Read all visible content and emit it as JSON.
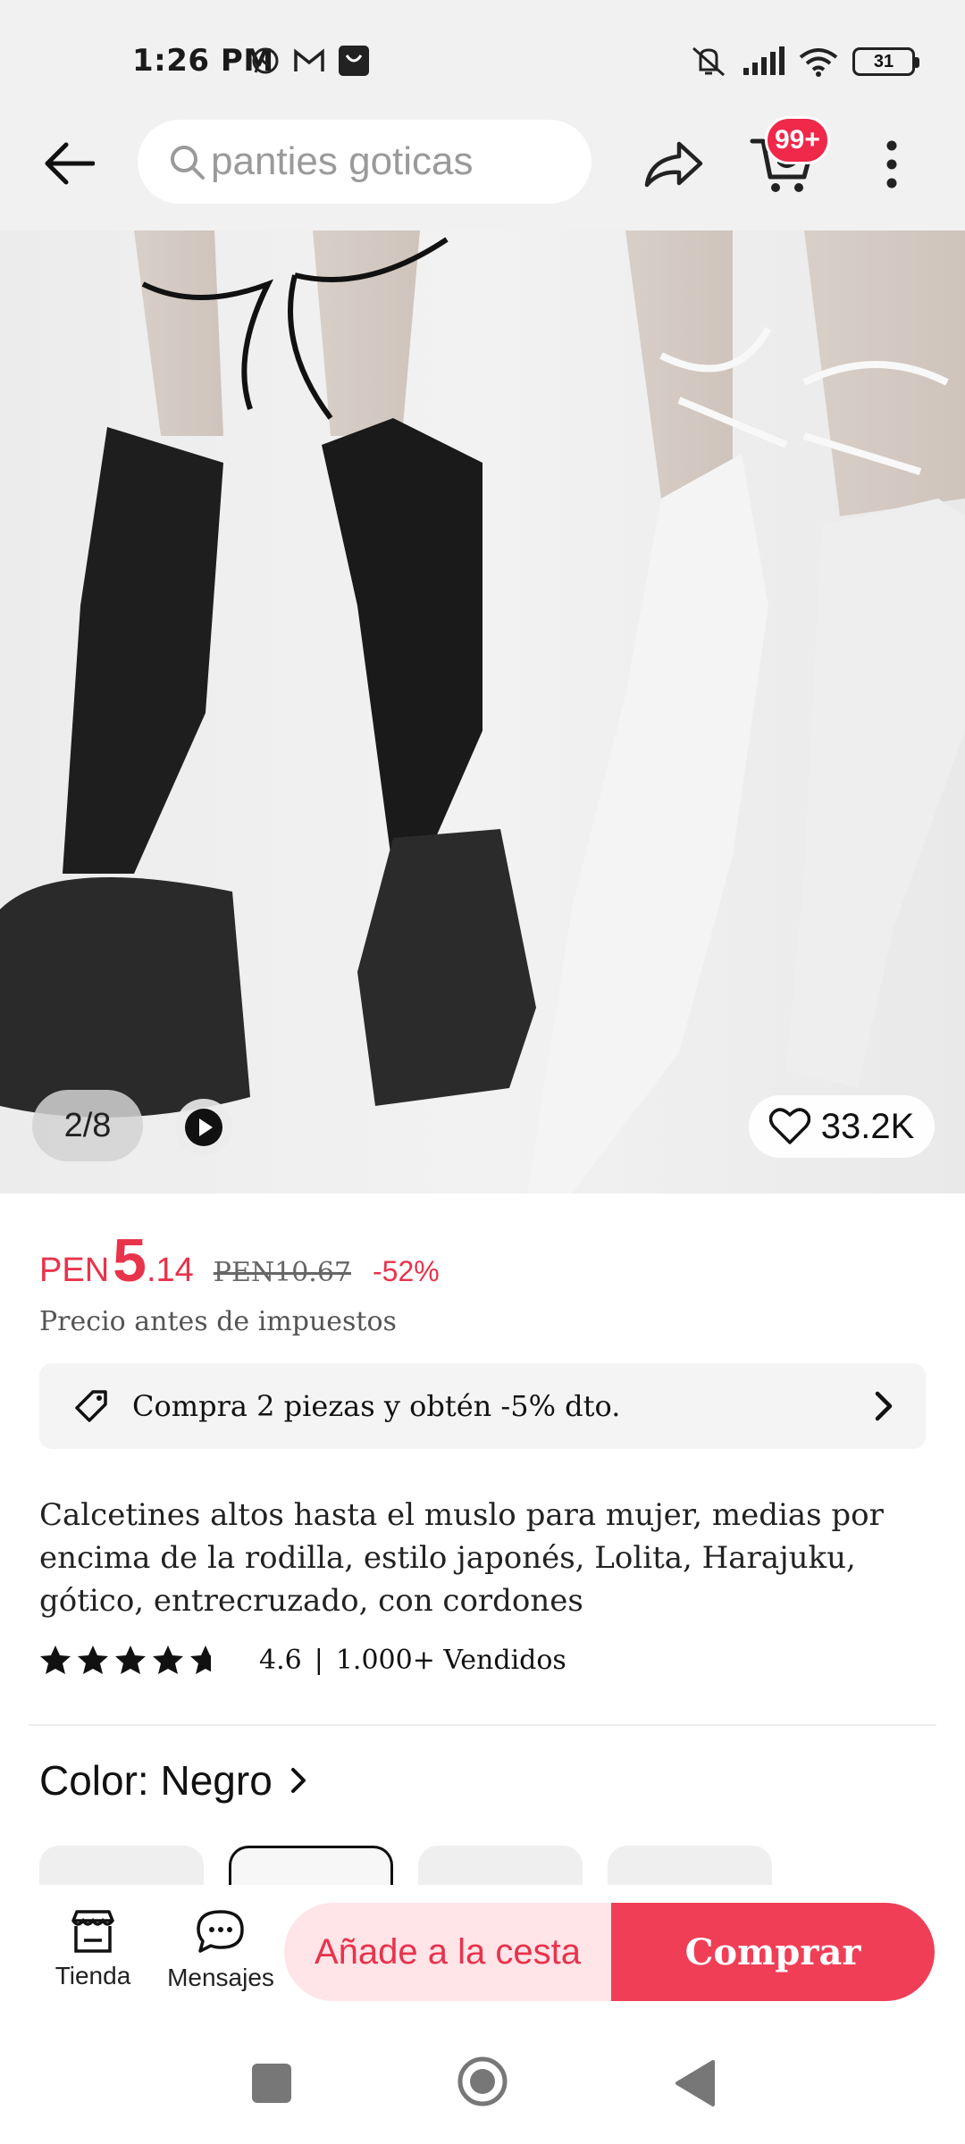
{
  "status_bar": {
    "time": "1:26 PM",
    "battery": "31"
  },
  "header": {
    "search_text": "panties goticas",
    "cart_badge": "99+"
  },
  "gallery": {
    "counter": "2/8",
    "wishlist_count": "33.2K"
  },
  "price": {
    "currency": "PEN",
    "integer": "5",
    "decimal": ".14",
    "original": "PEN10.67",
    "discount": "-52%",
    "tax_note": "Precio antes de impuestos"
  },
  "promo": {
    "text": "Compra 2 piezas y obtén -5% dto."
  },
  "product": {
    "title": "Calcetines altos hasta el muslo para mujer, medias por encima de la rodilla, estilo japonés, Lolita, Harajuku, gótico, entrecruzado, con cordones",
    "rating": "4.6",
    "sold": "1.000+ Vendidos",
    "rating_value": 4.6
  },
  "variant": {
    "label": "Color: Negro"
  },
  "bottom_bar": {
    "store_label": "Tienda",
    "messages_label": "Mensajes",
    "add_to_cart": "Añade a la cesta",
    "buy": "Comprar"
  },
  "colors": {
    "accent": "#f03e56",
    "accent_light": "#ffe4e8",
    "price": "#e8334b"
  }
}
